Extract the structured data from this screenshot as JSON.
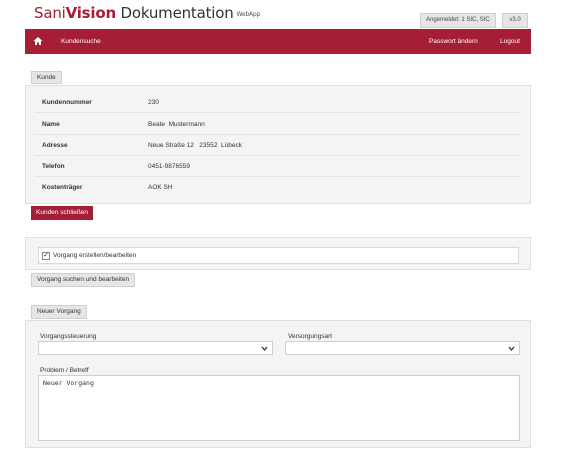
{
  "header": {
    "brand_part1": "Sani",
    "brand_part2": "Vision",
    "brand_part3": " Dokumentation",
    "brand_sub": "WebApp",
    "login_status": "Angemeldet: 1 SIC, SIC",
    "version": "v3.0"
  },
  "nav": {
    "home_icon": "home-icon",
    "customer_search": "Kundensuche",
    "change_password": "Passwort ändern",
    "logout": "Logout"
  },
  "customer": {
    "tab_label": "Kunde",
    "rows": [
      {
        "label": "Kundennummer",
        "value": "230"
      },
      {
        "label": "Name",
        "value": "Beate  Mustermann"
      },
      {
        "label": "Adresse",
        "value": "Neue Straße 12   23552  Lübeck"
      },
      {
        "label": "Telefon",
        "value": "0451-9876559"
      },
      {
        "label": "Kostenträger",
        "value": "AOK SH"
      }
    ],
    "close_button": "Kunden schließen"
  },
  "process": {
    "checkbox_label": "Vorgang erstellen/bearbeiten",
    "checkbox_checked": true,
    "search_button": "Vorgang suchen und bearbeiten"
  },
  "new_process": {
    "tab_label": "Neuer Vorgang",
    "control_label": "Vorgangssteuerung",
    "control_value": "",
    "supply_label": "Versorgungsart",
    "supply_value": "",
    "problem_label": "Problem / Betreff",
    "problem_value": "Neuer Vorgang"
  },
  "colors": {
    "brand": "#a51e36",
    "panel_bg": "#f4f4f4"
  }
}
